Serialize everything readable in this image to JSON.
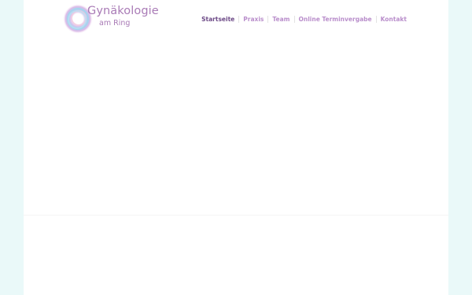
{
  "logo": {
    "title": "Gynäkologie",
    "subtitle": "am Ring",
    "icon": "ring-logo-icon"
  },
  "nav": {
    "items": [
      {
        "label": "Startseite",
        "active": true
      },
      {
        "label": "Praxis",
        "active": false
      },
      {
        "label": "Team",
        "active": false
      },
      {
        "label": "Online Terminvergabe",
        "active": false
      },
      {
        "label": "Kontakt",
        "active": false
      }
    ]
  },
  "colors": {
    "background": "#eaf9f9",
    "nav_active": "#6d4a87",
    "nav": "#b98ecb",
    "logo_text": "#a97bb6"
  }
}
